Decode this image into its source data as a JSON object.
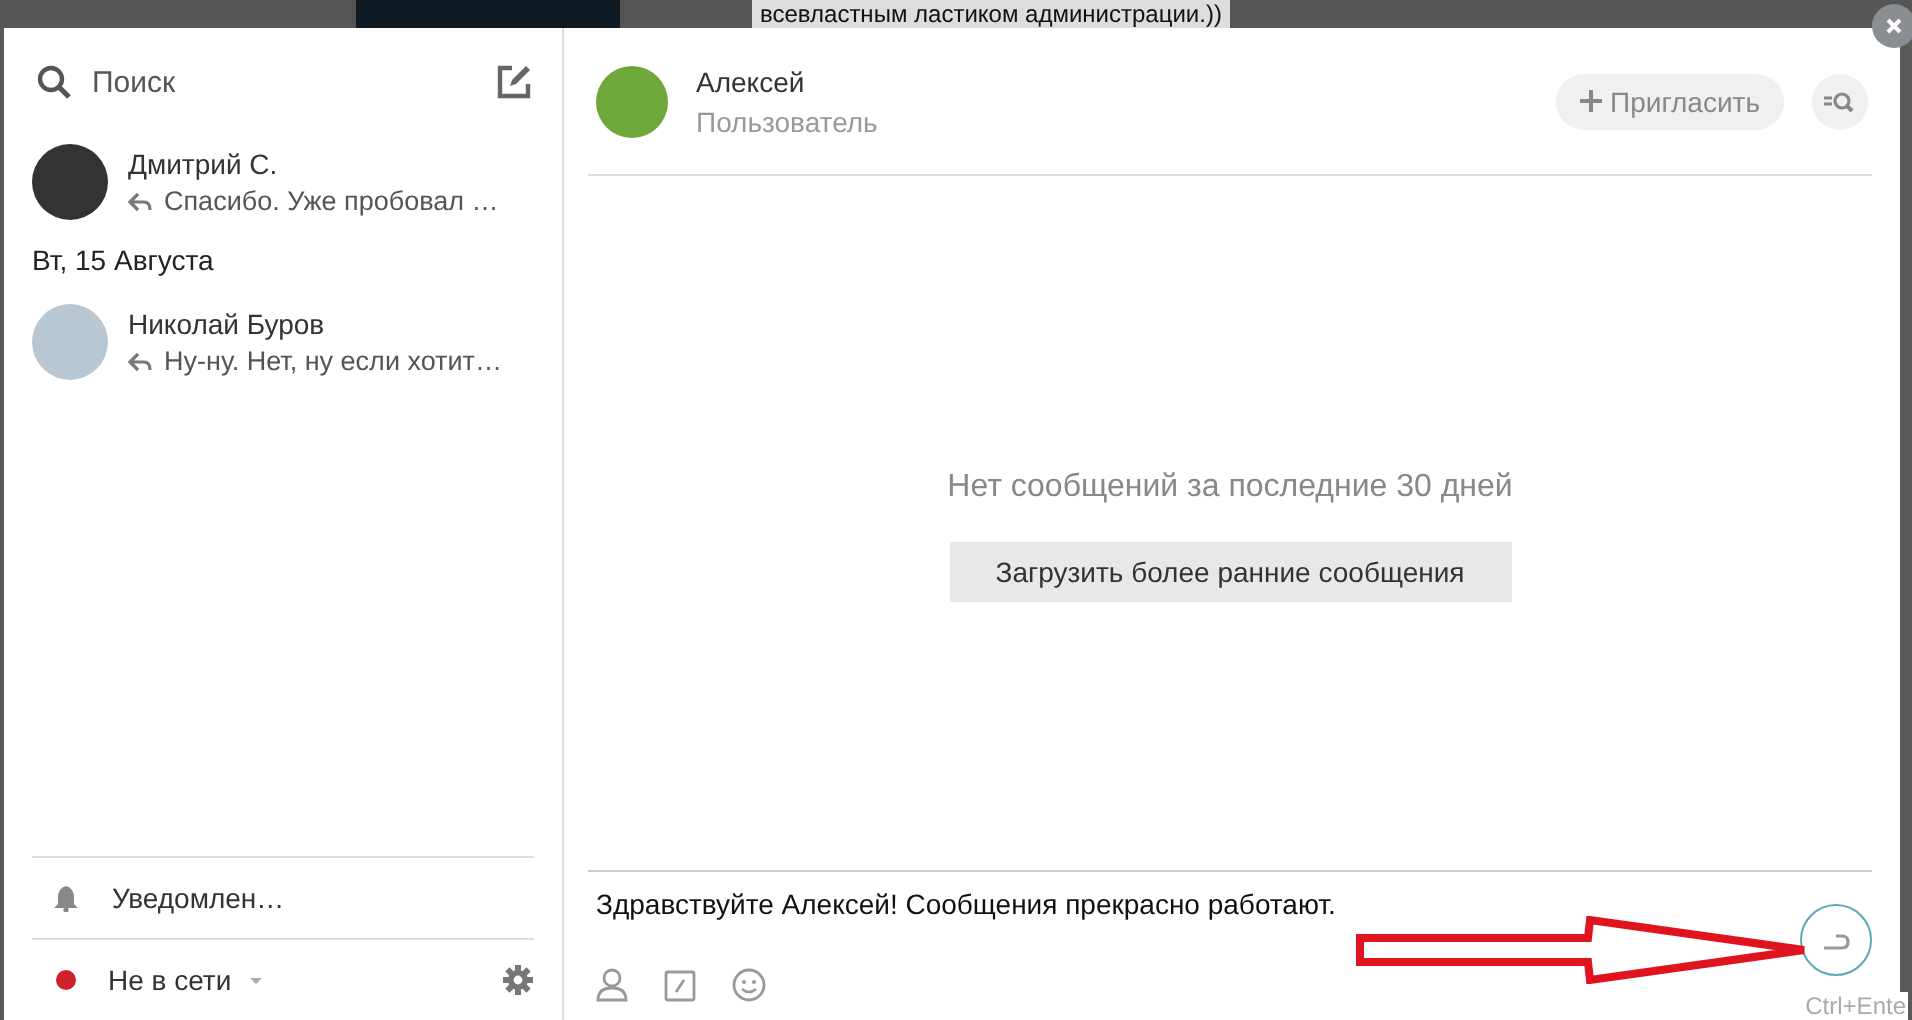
{
  "background": {
    "text": "всевластным ластиком администрации.))"
  },
  "sidebar": {
    "search": {
      "placeholder": "Поиск"
    },
    "conversations": [
      {
        "kind": "chat",
        "name": "Дмитрий С.",
        "preview": "Спасибо. Уже пробовал …",
        "selected": false
      },
      {
        "kind": "date",
        "label": "Вт, 15 Августа"
      },
      {
        "kind": "chat",
        "name": "Николай Буров",
        "preview": "Ну-ну. Нет, ну если хотит…",
        "selected": false
      }
    ],
    "notifications": "Уведомлен…",
    "status": {
      "label": "Не в сети",
      "color": "#d0202a"
    }
  },
  "chat": {
    "name": "Алексей",
    "role": "Пользователь",
    "invite": "Пригласить",
    "empty": "Нет сообщений за последние 30 дней",
    "load_button": "Загрузить более ранние сообщения",
    "message": "Здравствуйте Алексей! Сообщения прекрасно работают.",
    "send_hint": "Ctrl+Ente"
  }
}
